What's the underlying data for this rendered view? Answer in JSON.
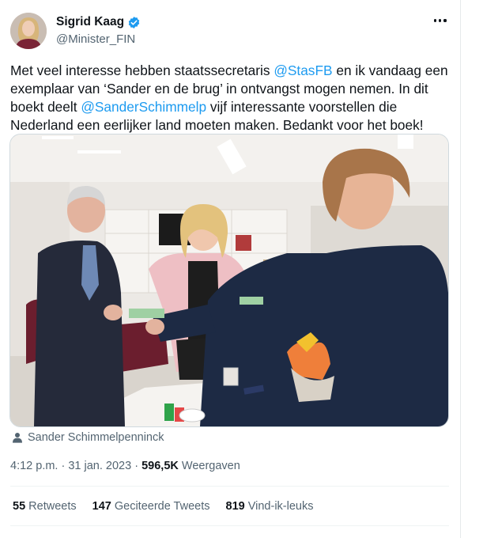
{
  "author": {
    "name": "Sigrid Kaag",
    "handle": "@Minister_FIN",
    "verified_color": "#1d9bf0"
  },
  "tweet": {
    "text_parts": [
      {
        "t": "Met veel interesse hebben staatssecretaris "
      },
      {
        "t": "@StasFB",
        "link": true
      },
      {
        "t": " en ik vandaag een exemplaar van ‘Sander en de brug’ in ontvangst mogen nemen. In dit boekt deelt "
      },
      {
        "t": "@SanderSchimmelp",
        "link": true
      },
      {
        "t": " vijf interessante voorstellen die Nederland een eerlijker land moeten maken. Bedankt voor het boek!"
      }
    ],
    "photo_credit": "Sander Schimmelpenninck",
    "time": "4:12 p.m.",
    "date": "31 jan. 2023",
    "views_count": "596,5K",
    "views_label": "Weergaven",
    "separator": "·"
  },
  "stats": {
    "retweets_count": "55",
    "retweets_label": "Retweets",
    "quotes_count": "147",
    "quotes_label": "Geciteerde Tweets",
    "likes_count": "819",
    "likes_label": "Vind-ik-leuks"
  },
  "colors": {
    "link": "#1d9bf0",
    "secondary_text": "#536471",
    "primary_text": "#0f1419"
  }
}
